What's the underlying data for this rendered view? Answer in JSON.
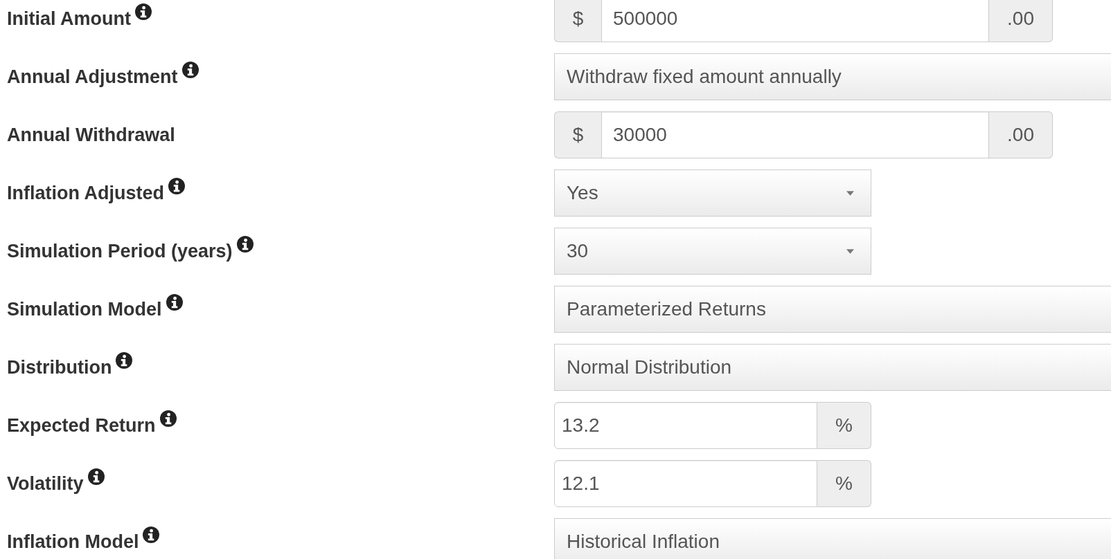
{
  "fields": [
    {
      "label": "Initial Amount",
      "info": true,
      "kind": "currency",
      "prefix": "$",
      "value": "500000",
      "suffix": ".00"
    },
    {
      "label": "Annual Adjustment",
      "info": true,
      "kind": "wide-select",
      "value": "Withdraw fixed amount annually"
    },
    {
      "label": "Annual Withdrawal",
      "info": false,
      "kind": "currency",
      "prefix": "$",
      "value": "30000",
      "suffix": ".00"
    },
    {
      "label": "Inflation Adjusted",
      "info": true,
      "kind": "select",
      "value": "Yes"
    },
    {
      "label": "Simulation Period (years)",
      "info": true,
      "kind": "select",
      "value": "30"
    },
    {
      "label": "Simulation Model",
      "info": true,
      "kind": "wide-select",
      "value": "Parameterized Returns"
    },
    {
      "label": "Distribution",
      "info": true,
      "kind": "wide-select",
      "value": "Normal Distribution"
    },
    {
      "label": "Expected Return",
      "info": true,
      "kind": "percent",
      "value": "13.2",
      "suffix": "%"
    },
    {
      "label": "Volatility",
      "info": true,
      "kind": "percent",
      "value": "12.1",
      "suffix": "%"
    },
    {
      "label": "Inflation Model",
      "info": true,
      "kind": "wide-select",
      "value": "Historical Inflation"
    }
  ]
}
